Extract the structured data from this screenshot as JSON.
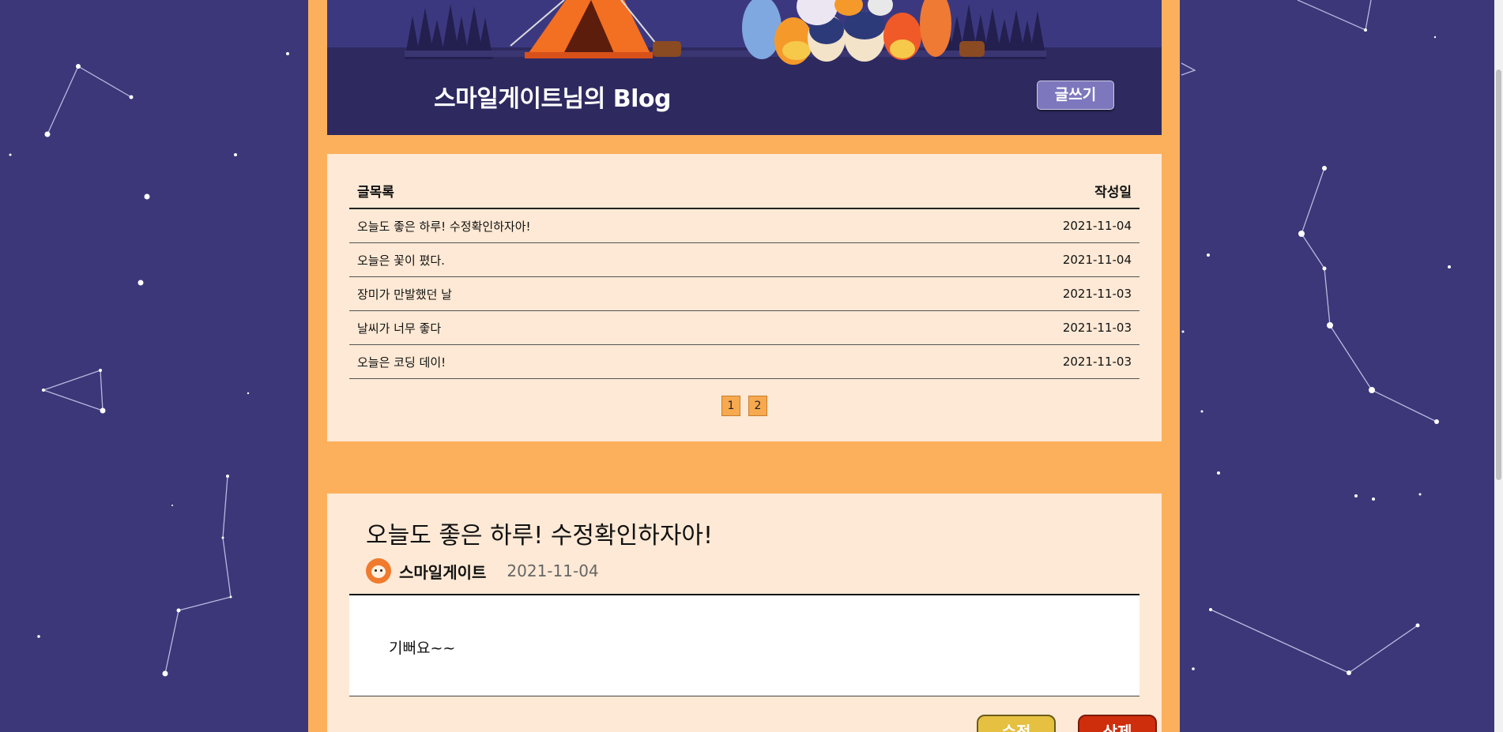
{
  "header": {
    "blog_title": "스마일게이트님의 Blog",
    "write_button": "글쓰기"
  },
  "post_list": {
    "columns": {
      "title": "글목록",
      "date": "작성일"
    },
    "rows": [
      {
        "title": "오늘도 좋은 하루! 수정확인하자아!",
        "date": "2021-11-04"
      },
      {
        "title": "오늘은 꽃이 폈다.",
        "date": "2021-11-04"
      },
      {
        "title": "장미가 만발했던 날",
        "date": "2021-11-03"
      },
      {
        "title": "날씨가 너무 좋다",
        "date": "2021-11-03"
      },
      {
        "title": "오늘은 코딩 데이!",
        "date": "2021-11-03"
      }
    ],
    "pages": [
      "1",
      "2"
    ]
  },
  "detail": {
    "title": "오늘도 좋은 하루! 수정확인하자아!",
    "author": "스마일게이트",
    "date": "2021-11-04",
    "body": "기뻐요~~",
    "edit_button": "수정",
    "delete_button": "삭제"
  },
  "colors": {
    "background": "#3b3779",
    "page": "#fdb05c",
    "panel": "#fde9d5",
    "header": "#2e2a60",
    "write_button": "#7d78bd",
    "edit_button": "#e5c041",
    "delete_button": "#cf2e0c"
  }
}
